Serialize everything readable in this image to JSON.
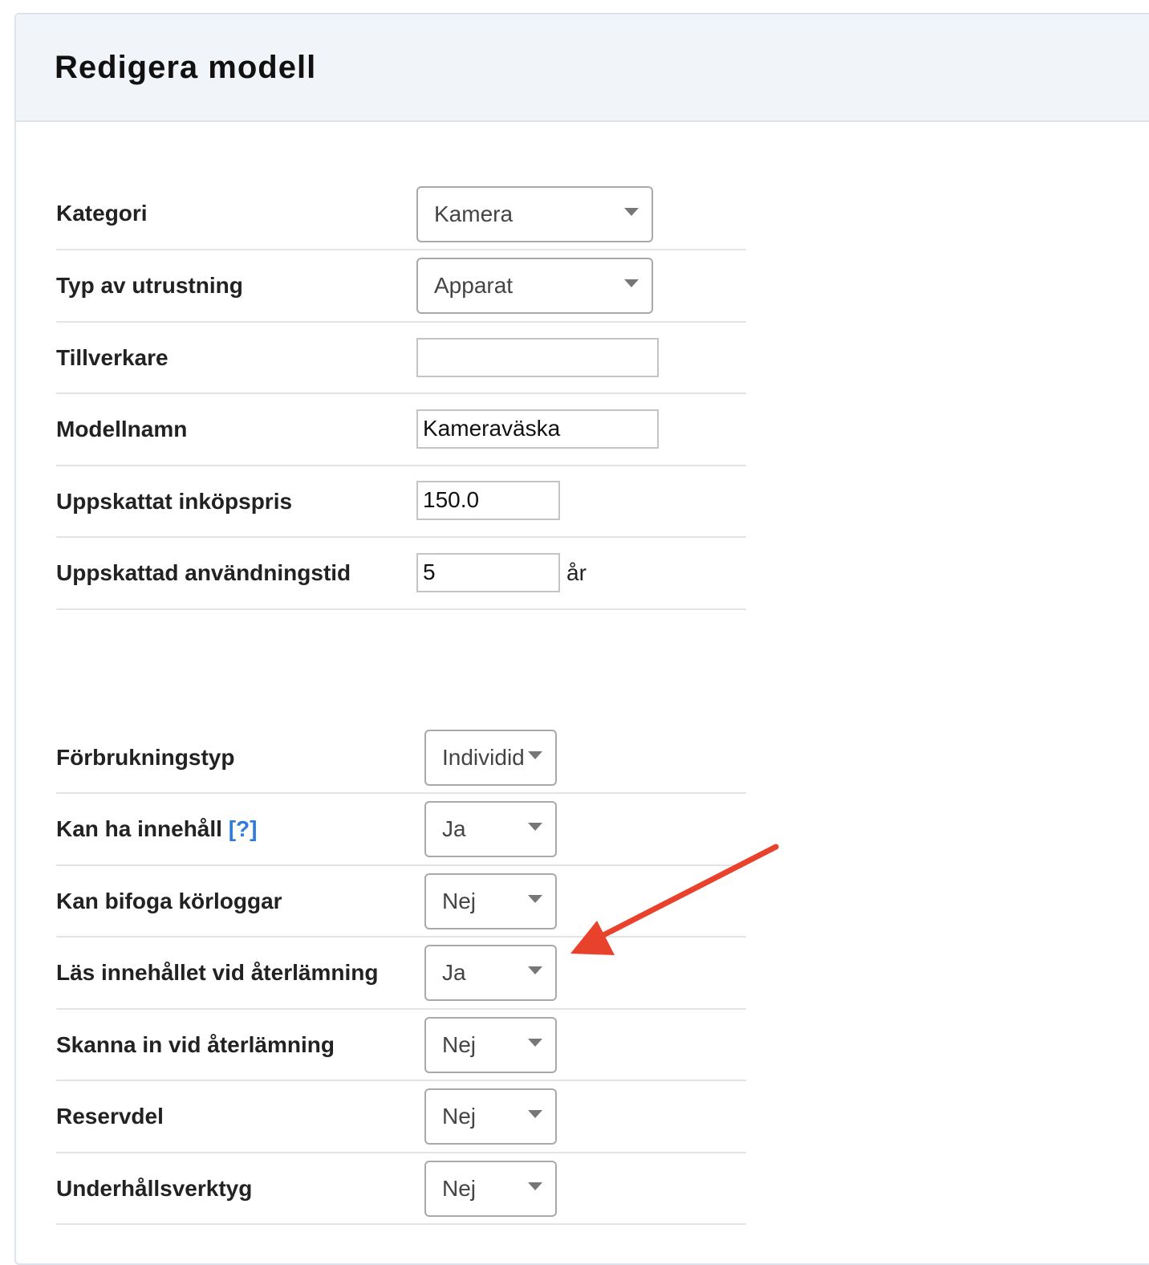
{
  "header": {
    "title": "Redigera modell"
  },
  "form": {
    "kategori": {
      "label": "Kategori",
      "value": "Kamera"
    },
    "typ": {
      "label": "Typ av utrustning",
      "value": "Apparat"
    },
    "tillverkare": {
      "label": "Tillverkare",
      "value": ""
    },
    "modellnamn": {
      "label": "Modellnamn",
      "value": "Kameraväska"
    },
    "inkopspris": {
      "label": "Uppskattat inköpspris",
      "value": "150.0"
    },
    "anvandningstid": {
      "label": "Uppskattad användningstid",
      "value": "5",
      "unit": "år"
    },
    "forbrukningstyp": {
      "label": "Förbrukningstyp",
      "value": "Individid"
    },
    "innehall": {
      "label": "Kan ha innehåll",
      "help": "[?]",
      "value": "Ja"
    },
    "korloggar": {
      "label": "Kan bifoga körloggar",
      "value": "Nej"
    },
    "las_innehall": {
      "label": "Läs innehållet vid återlämning",
      "value": "Ja"
    },
    "skanna": {
      "label": "Skanna in vid återlämning",
      "value": "Nej"
    },
    "reservdel": {
      "label": "Reservdel",
      "value": "Nej"
    },
    "underhall": {
      "label": "Underhållsverktyg",
      "value": "Nej"
    }
  },
  "annotation": {
    "arrow_color": "#e8412c"
  },
  "icons": {
    "caret": "chevron-down-icon",
    "arrow": "red-arrow-annotation"
  }
}
